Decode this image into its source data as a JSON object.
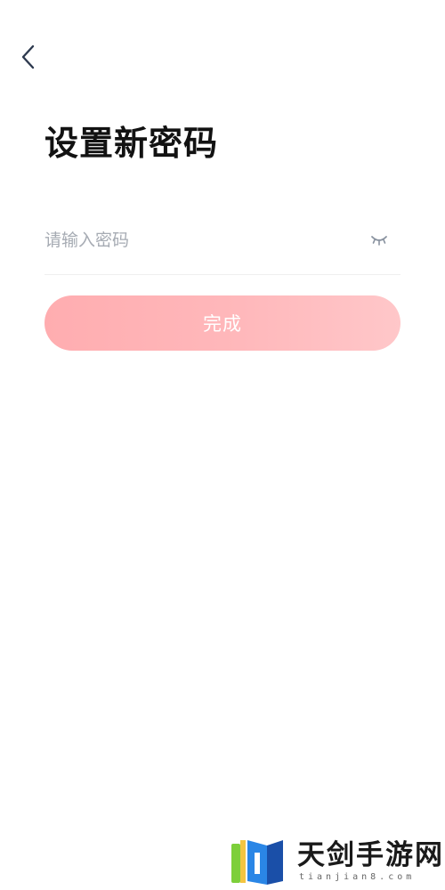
{
  "header": {
    "back_icon": "chevron-left-icon",
    "title": "设置新密码"
  },
  "form": {
    "password": {
      "value": "",
      "placeholder": "请输入密码",
      "visibility_icon": "eye-closed-icon"
    },
    "submit_label": "完成"
  },
  "watermark": {
    "title": "天剑手游网",
    "domain": "tianjian8.com"
  },
  "colors": {
    "background": "#ffffff",
    "title_text": "#121212",
    "placeholder_text": "#a6abb3",
    "divider": "#efefef",
    "button_gradient_start": "#ffadb0",
    "button_gradient_end": "#ffc7c9",
    "button_text": "#ffffff",
    "back_icon": "#2e3a4f"
  }
}
